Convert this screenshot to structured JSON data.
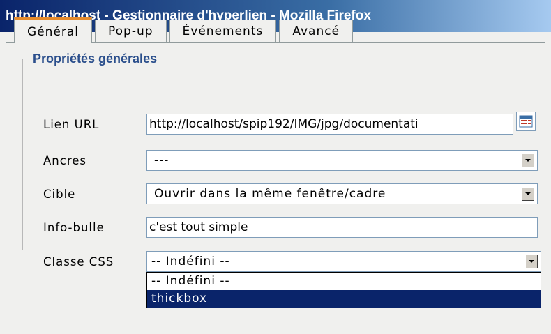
{
  "window": {
    "title": "http://localhost - Gestionnaire d'hyperlien - Mozilla Firefox"
  },
  "tabs": [
    {
      "label": "Général",
      "active": true
    },
    {
      "label": "Pop-up",
      "active": false
    },
    {
      "label": "Événements",
      "active": false
    },
    {
      "label": "Avancé",
      "active": false
    }
  ],
  "general": {
    "legend": "Propriétés générales",
    "url": {
      "label": "Lien URL",
      "value": "http://localhost/spip192/IMG/jpg/documentati"
    },
    "anchors": {
      "label": "Ancres",
      "value": "---"
    },
    "target": {
      "label": "Cible",
      "value": "Ouvrir dans la même fenêtre/cadre"
    },
    "tooltip": {
      "label": "Info-bulle",
      "value": "c'est tout simple"
    },
    "css_class": {
      "label": "Classe CSS",
      "value": "-- Indéfini --",
      "options": [
        "-- Indéfini --",
        "thickbox"
      ],
      "highlighted_option": "thickbox"
    }
  },
  "colors": {
    "titlebar_start": "#0a246a",
    "titlebar_end": "#a6caf0",
    "active_tab_accent": "#e68b2c",
    "legend_text": "#2b4f8c",
    "selection_highlight": "#0a246a"
  },
  "icons": {
    "browse": "file-browser-icon",
    "dropdown": "chevron-down-icon"
  }
}
